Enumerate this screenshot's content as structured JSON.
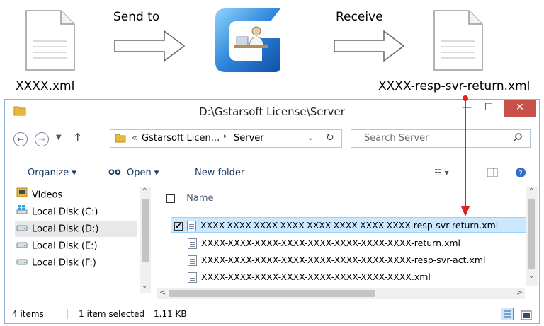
{
  "diagram": {
    "send_label": "Send to",
    "receive_label": "Receive",
    "source_file": "XXXX.xml",
    "result_file": "XXXX-resp-svr-return.xml"
  },
  "window": {
    "title": "D:\\Gstarsoft License\\Server",
    "minimize": "—",
    "maximize": "☐",
    "close": "✕"
  },
  "address": {
    "overflow": "«",
    "crumbs": [
      "Gstarsoft Licen...",
      "Server"
    ],
    "separator": "▸"
  },
  "search": {
    "placeholder": "Search Server"
  },
  "commands": {
    "organize": "Organize ▾",
    "open": "Open ▾",
    "new_folder": "New folder"
  },
  "nav_items": [
    {
      "label": "Videos",
      "icon": "videos-folder-icon"
    },
    {
      "label": "Local Disk (C:)",
      "icon": "windows-drive-icon"
    },
    {
      "label": "Local Disk (D:)",
      "icon": "drive-icon"
    },
    {
      "label": "Local Disk (E:)",
      "icon": "drive-icon"
    },
    {
      "label": "Local Disk (F:)",
      "icon": "drive-icon"
    }
  ],
  "file_list": {
    "header": "Name",
    "files": [
      {
        "name": "XXXX-XXXX-XXXX-XXXX-XXXX-XXXX-XXXX-XXXX-resp-svr-return.xml",
        "selected": true
      },
      {
        "name": "XXXX-XXXX-XXXX-XXXX-XXXX-XXXX-XXXX-XXXX-return.xml",
        "selected": false
      },
      {
        "name": "XXXX-XXXX-XXXX-XXXX-XXXX-XXXX-XXXX-XXXX-resp-svr-act.xml",
        "selected": false
      },
      {
        "name": "XXXX-XXXX-XXXX-XXXX-XXXX-XXXX-XXXX-XXXX.xml",
        "selected": false
      }
    ]
  },
  "status": {
    "item_count": "4 items",
    "selection": "1 item selected",
    "size": "1.11 KB"
  },
  "colors": {
    "accent": "#1a5fb4",
    "arrow": "#e02020",
    "selection": "#cce8ff",
    "close": "#c7504a"
  }
}
